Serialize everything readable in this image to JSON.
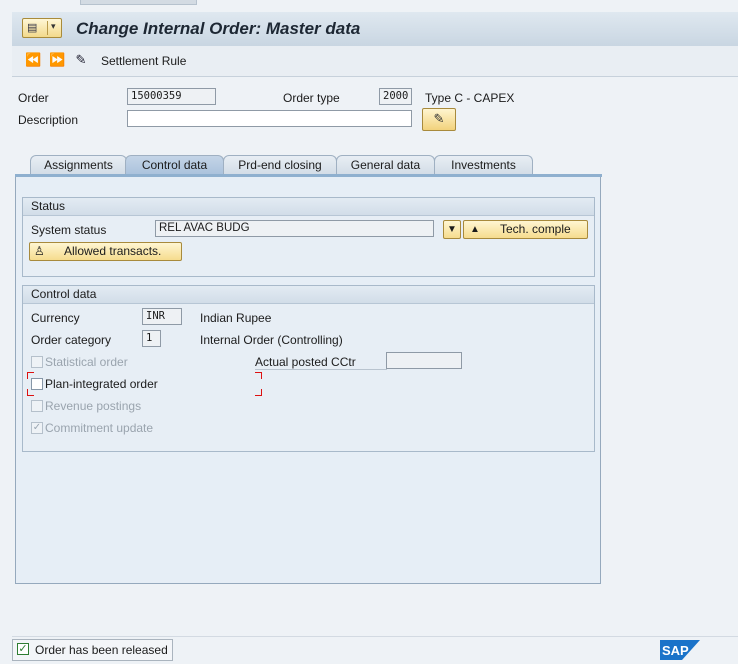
{
  "window": {
    "title": "Change Internal Order: Master data"
  },
  "toolbar": {
    "icons": [
      "previous-order-icon",
      "next-order-icon",
      "settlement-icon"
    ],
    "settlement_rule": "Settlement Rule"
  },
  "header": {
    "order_label": "Order",
    "order_value": "15000359",
    "order_type_label": "Order type",
    "order_type_value": "2000",
    "order_type_text": "Type C  - CAPEX",
    "description_label": "Description",
    "description_value": ""
  },
  "tabs": [
    {
      "label": "Assignments",
      "active": false
    },
    {
      "label": "Control data",
      "active": true
    },
    {
      "label": "Prd-end closing",
      "active": false
    },
    {
      "label": "General data",
      "active": false
    },
    {
      "label": "Investments",
      "active": false
    }
  ],
  "status_group": {
    "title": "Status",
    "system_status_label": "System status",
    "system_status_value": "REL  AVAC BUDG",
    "tech_complete_button": "Tech. comple",
    "allowed_transacts_button": "Allowed transacts."
  },
  "control_group": {
    "title": "Control data",
    "currency_label": "Currency",
    "currency_value": "INR",
    "currency_text": "Indian Rupee",
    "order_category_label": "Order category",
    "order_category_value": "1",
    "order_category_text": "Internal Order (Controlling)",
    "statistical_order": {
      "label": "Statistical order",
      "checked": false,
      "enabled": false
    },
    "actual_posted_cctr_label": "Actual posted CCtr",
    "actual_posted_cctr_value": "",
    "plan_integrated_order": {
      "label": "Plan-integrated order",
      "checked": false,
      "enabled": true
    },
    "revenue_postings": {
      "label": "Revenue postings",
      "checked": false,
      "enabled": false
    },
    "commitment_update": {
      "label": "Commitment update",
      "checked": true,
      "enabled": false
    }
  },
  "statusbar": {
    "message": "Order has been released",
    "logo": "SAP"
  },
  "colors": {
    "accent_yellow": "#f6dc8e",
    "tab_active": "#aac2dc",
    "status_ok": "#2e7d32"
  }
}
